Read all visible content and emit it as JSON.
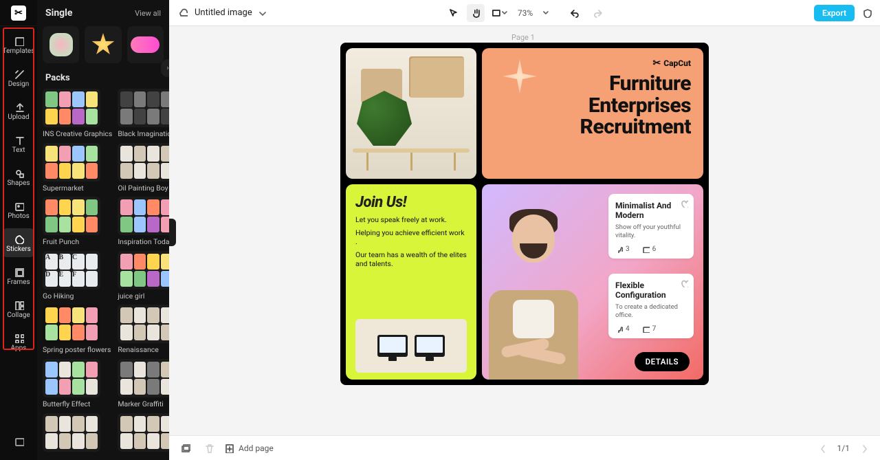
{
  "app": {
    "zoom": "73%",
    "title": "Untitled image",
    "export_label": "Export"
  },
  "left_nav": {
    "items": [
      {
        "label": "Templates"
      },
      {
        "label": "Design"
      },
      {
        "label": "Upload"
      },
      {
        "label": "Text"
      },
      {
        "label": "Shapes"
      },
      {
        "label": "Photos"
      },
      {
        "label": "Stickers"
      },
      {
        "label": "Frames"
      },
      {
        "label": "Collage"
      },
      {
        "label": "Apps"
      }
    ],
    "active_index": 6
  },
  "panel": {
    "single_title": "Single",
    "view_all": "View all",
    "packs_title": "Packs",
    "packs": [
      {
        "label": "INS Creative Graphics"
      },
      {
        "label": "Black Imagination"
      },
      {
        "label": "Supermarket"
      },
      {
        "label": "Oil Painting Boy"
      },
      {
        "label": "Fruit Punch"
      },
      {
        "label": "Inspiration Today"
      },
      {
        "label": "Go Hiking"
      },
      {
        "label": "juice girl"
      },
      {
        "label": "Spring poster flowers"
      },
      {
        "label": "Renaissance"
      },
      {
        "label": "Butterfly Effect"
      },
      {
        "label": "Marker Graffiti"
      }
    ]
  },
  "canvas": {
    "page_label": "Page 1",
    "brand": "CapCut",
    "headline_line1": "Furniture",
    "headline_line2": "Enterprises",
    "headline_line3": "Recruitment",
    "join_title": "Join Us!",
    "join_lines": [
      "Let you speak freely at work.",
      "Helping you achieve efficient work .",
      "Our team has a wealth of the elites and talents."
    ],
    "card1_title": "Minimalist And Modern",
    "card1_desc": "Show off your youthful vitality.",
    "card1_like": "3",
    "card1_comment": "6",
    "card2_title": "Flexible Configuration",
    "card2_desc": "To create a dedicated office.",
    "card2_like": "4",
    "card2_comment": "7",
    "details_label": "DETAILS"
  },
  "footer": {
    "add_page": "Add page",
    "page_counter": "1/1"
  }
}
